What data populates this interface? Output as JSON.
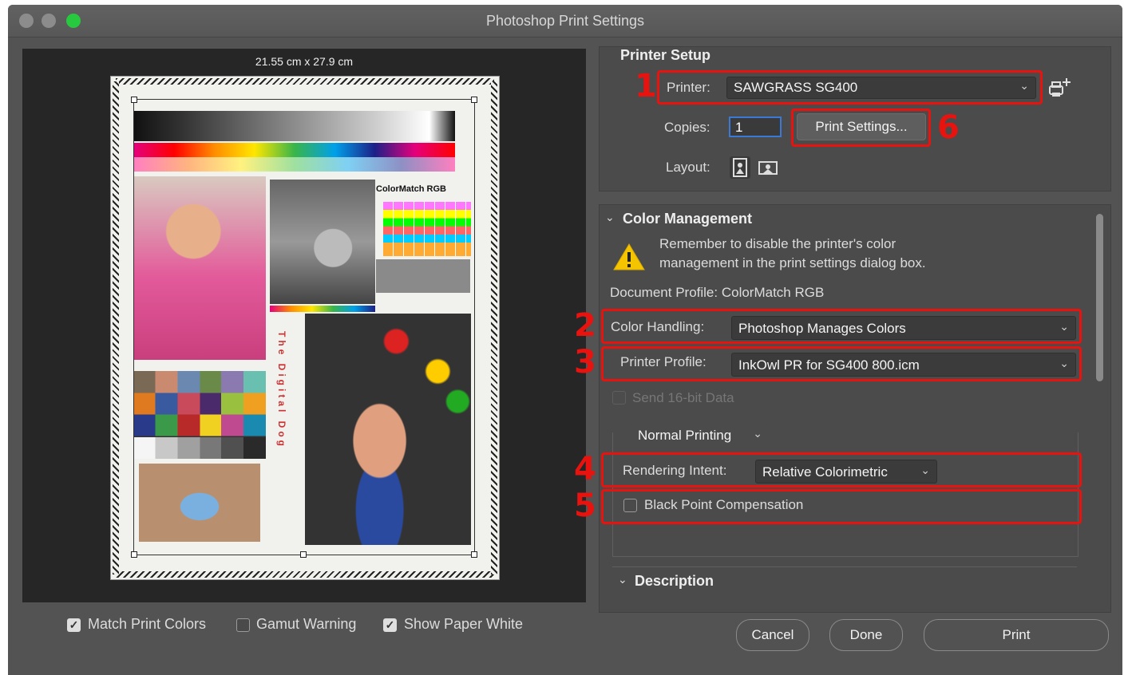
{
  "window": {
    "title": "Photoshop Print Settings"
  },
  "preview": {
    "paper_size": "21.55 cm x 27.9 cm"
  },
  "printer_setup": {
    "title": "Printer Setup",
    "printer_label": "Printer:",
    "printer_value": "SAWGRASS SG400",
    "copies_label": "Copies:",
    "copies_value": "1",
    "print_settings_button": "Print Settings...",
    "layout_label": "Layout:"
  },
  "color_management": {
    "title": "Color Management",
    "warning_line1": "Remember to disable the printer's color",
    "warning_line2": "management in the print settings dialog box.",
    "document_profile": "Document Profile: ColorMatch RGB",
    "color_handling_label": "Color Handling:",
    "color_handling_value": "Photoshop Manages Colors",
    "printer_profile_label": "Printer Profile:",
    "printer_profile_value": "InkOwl PR for SG400 800.icm",
    "send_16bit_label": "Send 16-bit Data",
    "normal_printing_value": "Normal Printing",
    "rendering_intent_label": "Rendering Intent:",
    "rendering_intent_value": "Relative Colorimetric",
    "black_point_label": "Black Point Compensation"
  },
  "description": {
    "title": "Description"
  },
  "bottom": {
    "match_print_colors": "Match Print Colors",
    "gamut_warning": "Gamut Warning",
    "show_paper_white": "Show Paper White",
    "match_print_colors_checked": true,
    "gamut_warning_checked": false,
    "show_paper_white_checked": true
  },
  "buttons": {
    "cancel": "Cancel",
    "done": "Done",
    "print": "Print"
  },
  "annotations": [
    "1",
    "2",
    "3",
    "4",
    "5",
    "6"
  ],
  "artwork": {
    "colormatch_label": "ColorMatch RGB",
    "vertical_text": "The Digital Dog"
  },
  "colors": {
    "annotation_red": "#e8130f",
    "window_bg": "#535353",
    "preview_bg": "#262626"
  }
}
